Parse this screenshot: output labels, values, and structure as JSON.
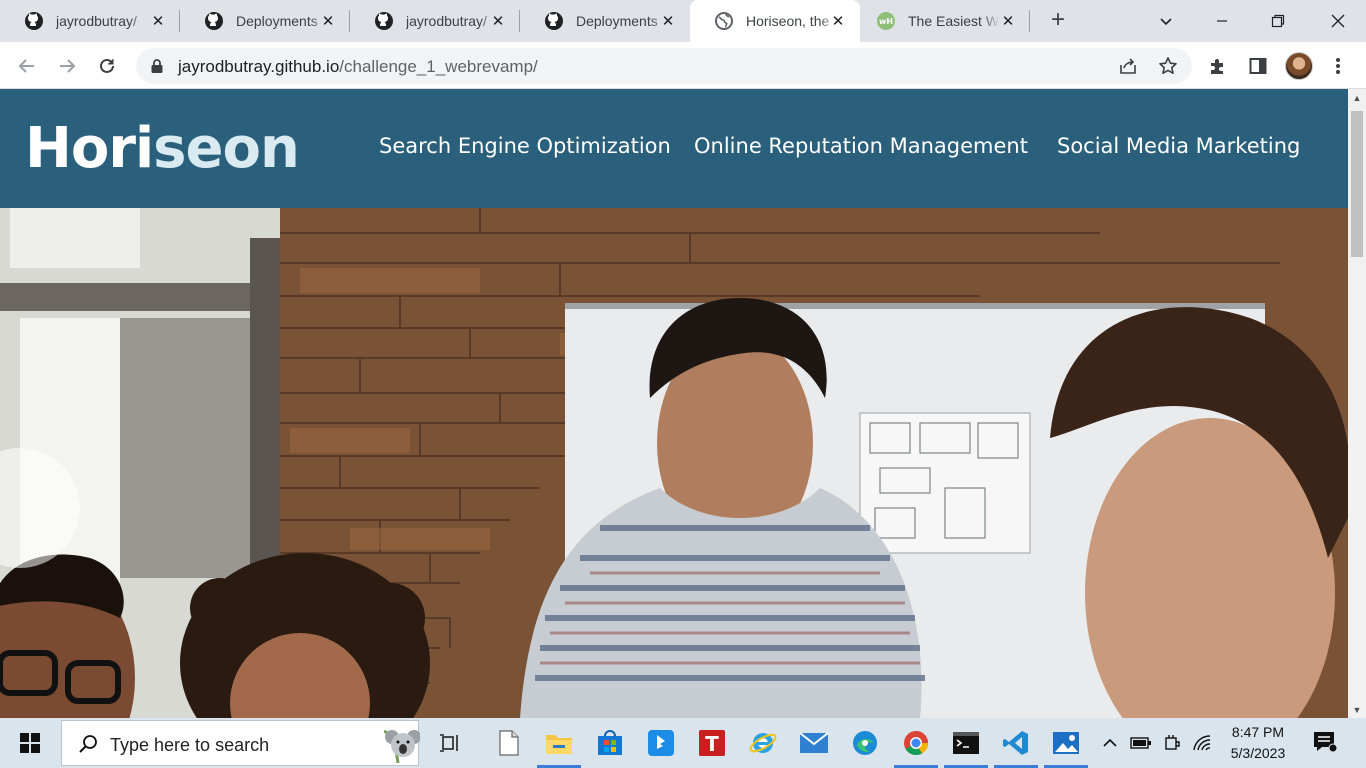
{
  "browser": {
    "tabs": [
      {
        "title": "jayrodbutray/",
        "favicon": "github-icon"
      },
      {
        "title": "Deployments",
        "favicon": "github-icon"
      },
      {
        "title": "jayrodbutray/",
        "favicon": "github-icon"
      },
      {
        "title": "Deployments",
        "favicon": "github-icon"
      },
      {
        "title": "Horiseon, the",
        "favicon": "globe-icon",
        "active": true
      },
      {
        "title": "The Easiest W",
        "favicon": "wh-icon"
      }
    ],
    "address": {
      "host": "jayrodbutray.github.io",
      "path": "/challenge_1_webrevamp/"
    }
  },
  "page": {
    "logo": {
      "part1": "Hori",
      "part2": "seon"
    },
    "nav": [
      "Search Engine Optimization",
      "Online Reputation Management",
      "Social Media Marketing"
    ],
    "colors": {
      "header": "#2a607c",
      "logo_accent": "#d9eaf1"
    }
  },
  "taskbar": {
    "search_placeholder": "Type here to search",
    "time": "8:47 PM",
    "date": "5/3/2023",
    "apps": [
      "task-view",
      "file",
      "file-explorer",
      "microsoft-store",
      "bing",
      "t-app",
      "internet-explorer",
      "mail",
      "edge",
      "chrome",
      "terminal",
      "vscode",
      "photos"
    ]
  }
}
